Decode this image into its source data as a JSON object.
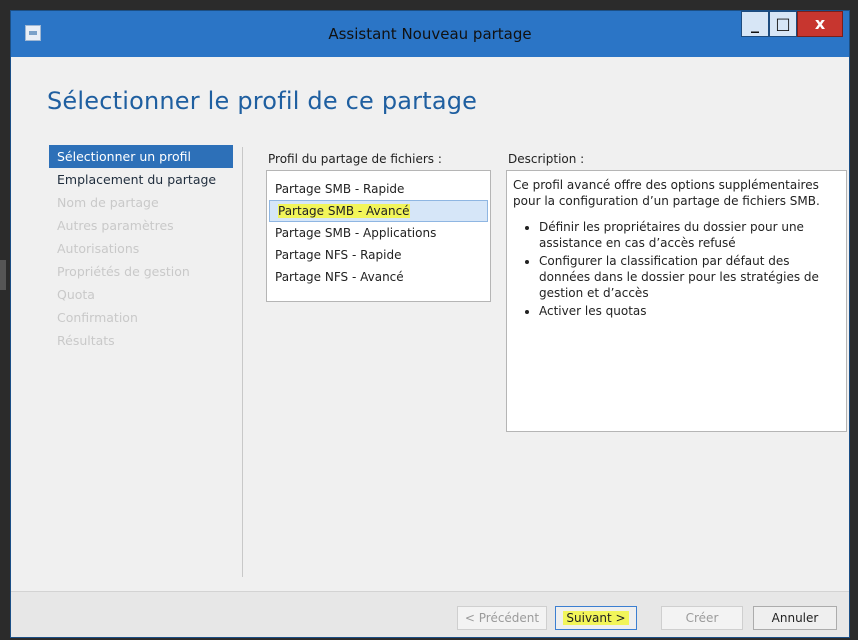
{
  "window": {
    "title": "Assistant Nouveau partage",
    "controls": {
      "minimize": "_",
      "maximize": "□",
      "close": "x"
    }
  },
  "page": {
    "title": "Sélectionner le profil de ce partage"
  },
  "steps": [
    {
      "label": "Sélectionner un profil",
      "state": "active"
    },
    {
      "label": "Emplacement du partage",
      "state": "enabled"
    },
    {
      "label": "Nom de partage",
      "state": "disabled"
    },
    {
      "label": "Autres paramètres",
      "state": "disabled"
    },
    {
      "label": "Autorisations",
      "state": "disabled"
    },
    {
      "label": "Propriétés de gestion",
      "state": "disabled"
    },
    {
      "label": "Quota",
      "state": "disabled"
    },
    {
      "label": "Confirmation",
      "state": "disabled"
    },
    {
      "label": "Résultats",
      "state": "disabled"
    }
  ],
  "profile": {
    "label": "Profil du partage de fichiers :",
    "items": [
      {
        "label": "Partage SMB - Rapide"
      },
      {
        "label": "Partage SMB - Avancé",
        "selected": true
      },
      {
        "label": "Partage SMB - Applications"
      },
      {
        "label": "Partage NFS - Rapide"
      },
      {
        "label": "Partage NFS - Avancé"
      }
    ]
  },
  "description": {
    "label": "Description :",
    "intro": "Ce profil avancé offre des options supplémentaires pour la configuration d’un partage de fichiers SMB.",
    "bullets": [
      "Définir les propriétaires du dossier pour une assistance en cas d’accès refusé",
      "Configurer la classification par défaut des données dans le dossier pour les stratégies de gestion et d’accès",
      "Activer les quotas"
    ]
  },
  "footer": {
    "previous": "< Précédent",
    "next": "Suivant >",
    "create": "Créer",
    "cancel": "Annuler"
  },
  "colors": {
    "titlebar": "#2b75c6",
    "accent": "#2d70b8",
    "highlight": "#f2f55a",
    "close": "#c7362f"
  }
}
